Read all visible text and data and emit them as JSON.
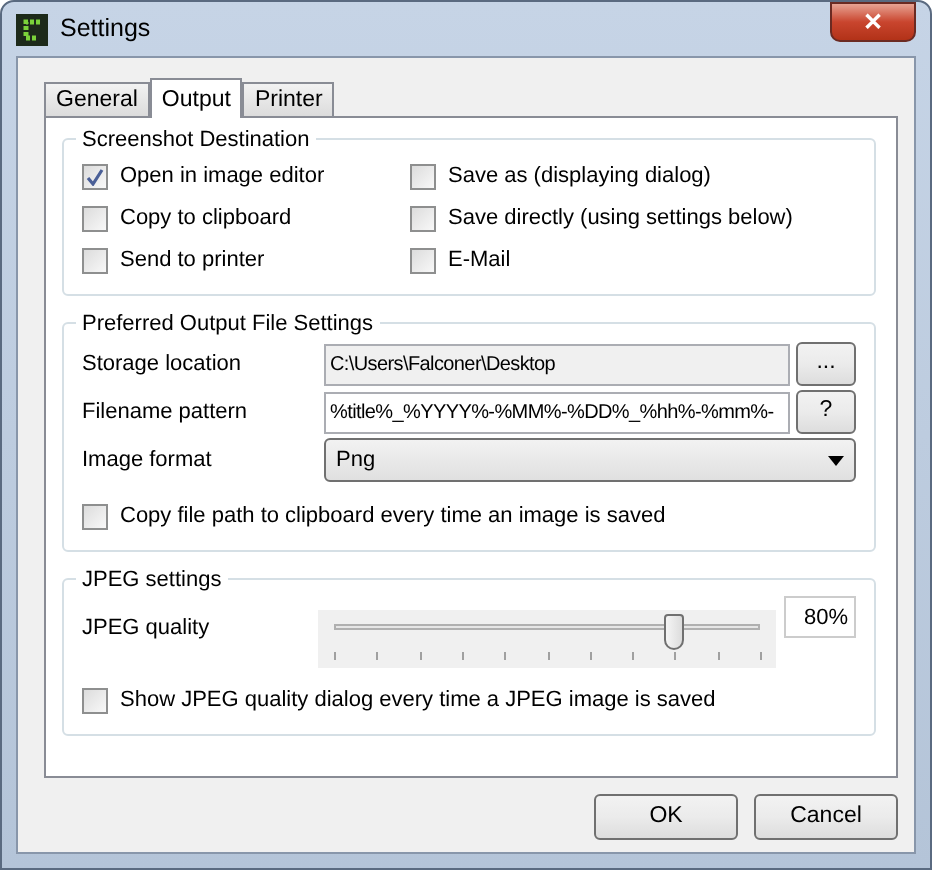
{
  "window": {
    "title": "Settings",
    "close": "✕"
  },
  "tabs": [
    {
      "label": "General",
      "selected": false
    },
    {
      "label": "Output",
      "selected": true
    },
    {
      "label": "Printer",
      "selected": false
    }
  ],
  "groups": [
    {
      "title": "Screenshot Destination",
      "checkboxes": [
        {
          "label": "Open in image editor",
          "checked": true
        },
        {
          "label": "Save as (displaying dialog)",
          "checked": false
        },
        {
          "label": "Copy to clipboard",
          "checked": false
        },
        {
          "label": "Save directly (using settings below)",
          "checked": false
        },
        {
          "label": "Send to printer",
          "checked": false
        },
        {
          "label": "E-Mail",
          "checked": false
        }
      ]
    },
    {
      "title": "Preferred Output File Settings",
      "rows": [
        {
          "kind": "text",
          "label": "Storage location",
          "value": "C:\\Users\\Falconer\\Desktop",
          "disabled": true,
          "button": "..."
        },
        {
          "kind": "text",
          "label": "Filename pattern",
          "value": "%title%_%YYYY%-%MM%-%DD%_%hh%-%mm%-",
          "disabled": false,
          "button": "?"
        },
        {
          "kind": "select",
          "label": "Image format",
          "value": "Png"
        },
        {
          "kind": "check",
          "label": "Copy file path to clipboard every time an image is saved",
          "checked": false
        }
      ]
    },
    {
      "title": "JPEG settings",
      "rows": [
        {
          "kind": "slider",
          "label": "JPEG quality",
          "level": 0.8,
          "reading": "80%"
        },
        {
          "kind": "check",
          "label": "Show JPEG quality dialog every time a JPEG image is saved",
          "checked": false
        }
      ]
    }
  ],
  "buttons": [
    "OK",
    "Cancel"
  ]
}
